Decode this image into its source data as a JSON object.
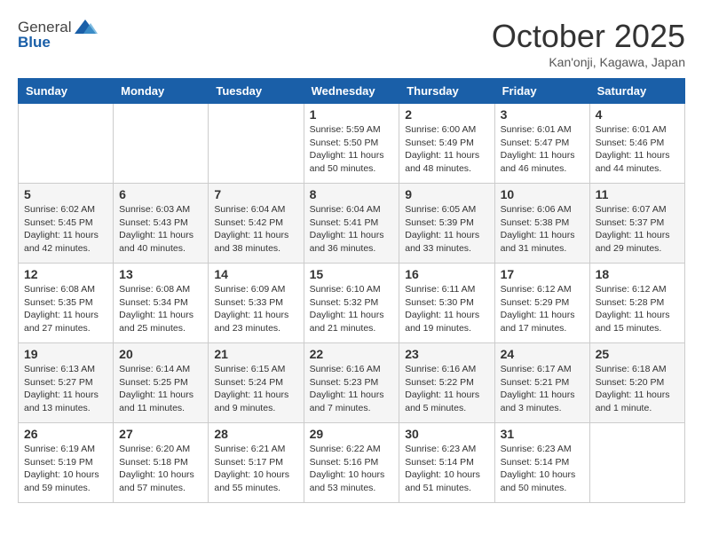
{
  "header": {
    "logo_general": "General",
    "logo_blue": "Blue",
    "month_title": "October 2025",
    "subtitle": "Kan'onji, Kagawa, Japan"
  },
  "days_of_week": [
    "Sunday",
    "Monday",
    "Tuesday",
    "Wednesday",
    "Thursday",
    "Friday",
    "Saturday"
  ],
  "weeks": [
    [
      {
        "day": "",
        "info": ""
      },
      {
        "day": "",
        "info": ""
      },
      {
        "day": "",
        "info": ""
      },
      {
        "day": "1",
        "info": "Sunrise: 5:59 AM\nSunset: 5:50 PM\nDaylight: 11 hours and 50 minutes."
      },
      {
        "day": "2",
        "info": "Sunrise: 6:00 AM\nSunset: 5:49 PM\nDaylight: 11 hours and 48 minutes."
      },
      {
        "day": "3",
        "info": "Sunrise: 6:01 AM\nSunset: 5:47 PM\nDaylight: 11 hours and 46 minutes."
      },
      {
        "day": "4",
        "info": "Sunrise: 6:01 AM\nSunset: 5:46 PM\nDaylight: 11 hours and 44 minutes."
      }
    ],
    [
      {
        "day": "5",
        "info": "Sunrise: 6:02 AM\nSunset: 5:45 PM\nDaylight: 11 hours and 42 minutes."
      },
      {
        "day": "6",
        "info": "Sunrise: 6:03 AM\nSunset: 5:43 PM\nDaylight: 11 hours and 40 minutes."
      },
      {
        "day": "7",
        "info": "Sunrise: 6:04 AM\nSunset: 5:42 PM\nDaylight: 11 hours and 38 minutes."
      },
      {
        "day": "8",
        "info": "Sunrise: 6:04 AM\nSunset: 5:41 PM\nDaylight: 11 hours and 36 minutes."
      },
      {
        "day": "9",
        "info": "Sunrise: 6:05 AM\nSunset: 5:39 PM\nDaylight: 11 hours and 33 minutes."
      },
      {
        "day": "10",
        "info": "Sunrise: 6:06 AM\nSunset: 5:38 PM\nDaylight: 11 hours and 31 minutes."
      },
      {
        "day": "11",
        "info": "Sunrise: 6:07 AM\nSunset: 5:37 PM\nDaylight: 11 hours and 29 minutes."
      }
    ],
    [
      {
        "day": "12",
        "info": "Sunrise: 6:08 AM\nSunset: 5:35 PM\nDaylight: 11 hours and 27 minutes."
      },
      {
        "day": "13",
        "info": "Sunrise: 6:08 AM\nSunset: 5:34 PM\nDaylight: 11 hours and 25 minutes."
      },
      {
        "day": "14",
        "info": "Sunrise: 6:09 AM\nSunset: 5:33 PM\nDaylight: 11 hours and 23 minutes."
      },
      {
        "day": "15",
        "info": "Sunrise: 6:10 AM\nSunset: 5:32 PM\nDaylight: 11 hours and 21 minutes."
      },
      {
        "day": "16",
        "info": "Sunrise: 6:11 AM\nSunset: 5:30 PM\nDaylight: 11 hours and 19 minutes."
      },
      {
        "day": "17",
        "info": "Sunrise: 6:12 AM\nSunset: 5:29 PM\nDaylight: 11 hours and 17 minutes."
      },
      {
        "day": "18",
        "info": "Sunrise: 6:12 AM\nSunset: 5:28 PM\nDaylight: 11 hours and 15 minutes."
      }
    ],
    [
      {
        "day": "19",
        "info": "Sunrise: 6:13 AM\nSunset: 5:27 PM\nDaylight: 11 hours and 13 minutes."
      },
      {
        "day": "20",
        "info": "Sunrise: 6:14 AM\nSunset: 5:25 PM\nDaylight: 11 hours and 11 minutes."
      },
      {
        "day": "21",
        "info": "Sunrise: 6:15 AM\nSunset: 5:24 PM\nDaylight: 11 hours and 9 minutes."
      },
      {
        "day": "22",
        "info": "Sunrise: 6:16 AM\nSunset: 5:23 PM\nDaylight: 11 hours and 7 minutes."
      },
      {
        "day": "23",
        "info": "Sunrise: 6:16 AM\nSunset: 5:22 PM\nDaylight: 11 hours and 5 minutes."
      },
      {
        "day": "24",
        "info": "Sunrise: 6:17 AM\nSunset: 5:21 PM\nDaylight: 11 hours and 3 minutes."
      },
      {
        "day": "25",
        "info": "Sunrise: 6:18 AM\nSunset: 5:20 PM\nDaylight: 11 hours and 1 minute."
      }
    ],
    [
      {
        "day": "26",
        "info": "Sunrise: 6:19 AM\nSunset: 5:19 PM\nDaylight: 10 hours and 59 minutes."
      },
      {
        "day": "27",
        "info": "Sunrise: 6:20 AM\nSunset: 5:18 PM\nDaylight: 10 hours and 57 minutes."
      },
      {
        "day": "28",
        "info": "Sunrise: 6:21 AM\nSunset: 5:17 PM\nDaylight: 10 hours and 55 minutes."
      },
      {
        "day": "29",
        "info": "Sunrise: 6:22 AM\nSunset: 5:16 PM\nDaylight: 10 hours and 53 minutes."
      },
      {
        "day": "30",
        "info": "Sunrise: 6:23 AM\nSunset: 5:14 PM\nDaylight: 10 hours and 51 minutes."
      },
      {
        "day": "31",
        "info": "Sunrise: 6:23 AM\nSunset: 5:14 PM\nDaylight: 10 hours and 50 minutes."
      },
      {
        "day": "",
        "info": ""
      }
    ]
  ]
}
